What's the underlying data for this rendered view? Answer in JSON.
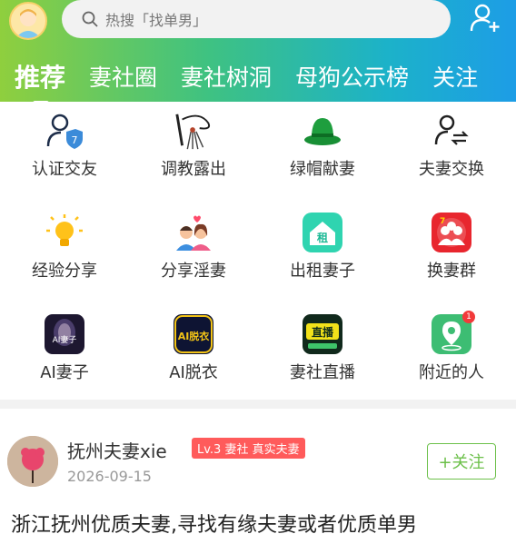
{
  "header": {
    "search_placeholder": "热搜「找单男」",
    "tabs": [
      "推荐",
      "妻社圈",
      "妻社树洞",
      "母狗公示榜",
      "关注"
    ]
  },
  "grid": [
    {
      "label": "认证交友",
      "icon": "verified-user-icon"
    },
    {
      "label": "调教露出",
      "icon": "whip-icon"
    },
    {
      "label": "绿帽献妻",
      "icon": "green-hat-icon"
    },
    {
      "label": "夫妻交换",
      "icon": "user-exchange-icon"
    },
    {
      "label": "经验分享",
      "icon": "lightbulb-icon"
    },
    {
      "label": "分享淫妻",
      "icon": "couple-icon"
    },
    {
      "label": "出租妻子",
      "icon": "rent-house-icon"
    },
    {
      "label": "换妻群",
      "icon": "group-chat-icon"
    },
    {
      "label": "AI妻子",
      "icon": "ai-wife-app-icon",
      "icon_text": "AI妻子"
    },
    {
      "label": "AI脱衣",
      "icon": "ai-undress-app-icon",
      "icon_text": "AI脱衣"
    },
    {
      "label": "妻社直播",
      "icon": "live-stream-app-icon",
      "icon_text": "直播"
    },
    {
      "label": "附近的人",
      "icon": "nearby-map-icon",
      "badge": "1"
    }
  ],
  "post": {
    "author": "抚州夫妻xie",
    "badge": "Lv.3 妻社 真实夫妻",
    "date": "2026-09-15",
    "follow_label": "+关注",
    "text": "浙江抚州优质夫妻,寻找有缘夫妻或者优质单男"
  }
}
